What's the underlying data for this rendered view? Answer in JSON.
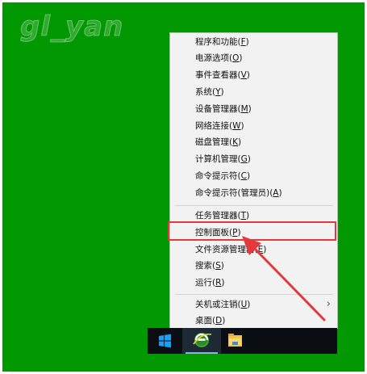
{
  "watermark": "gl_yan",
  "menu": {
    "items": [
      {
        "label": "程序和功能(",
        "key": "F",
        "end": ")"
      },
      {
        "label": "电源选项(",
        "key": "O",
        "end": ")"
      },
      {
        "label": "事件查看器(",
        "key": "V",
        "end": ")"
      },
      {
        "label": "系统(",
        "key": "Y",
        "end": ")"
      },
      {
        "label": "设备管理器(",
        "key": "M",
        "end": ")"
      },
      {
        "label": "网络连接(",
        "key": "W",
        "end": ")"
      },
      {
        "label": "磁盘管理(",
        "key": "K",
        "end": ")"
      },
      {
        "label": "计算机管理(",
        "key": "G",
        "end": ")"
      },
      {
        "label": "命令提示符(",
        "key": "C",
        "end": ")"
      },
      {
        "label": "命令提示符(管理员)(",
        "key": "A",
        "end": ")"
      },
      {
        "label": "任务管理器(",
        "key": "T",
        "end": ")"
      },
      {
        "label": "控制面板(",
        "key": "P",
        "end": ")"
      },
      {
        "label": "文件资源管理器(",
        "key": "E",
        "end": ")"
      },
      {
        "label": "搜索(",
        "key": "S",
        "end": ")"
      },
      {
        "label": "运行(",
        "key": "R",
        "end": ")"
      },
      {
        "label": "关机或注销(",
        "key": "U",
        "end": ")"
      },
      {
        "label": "桌面(",
        "key": "D",
        "end": ")"
      }
    ],
    "submenu_arrow": "›"
  },
  "colors": {
    "desktop": "#029802",
    "highlight": "#e23a3a",
    "taskbar": "#0a0d12",
    "start": "#1e9df2"
  },
  "taskbar": {
    "icons": [
      "windows-start-icon",
      "internet-explorer-icon",
      "file-explorer-icon"
    ]
  }
}
